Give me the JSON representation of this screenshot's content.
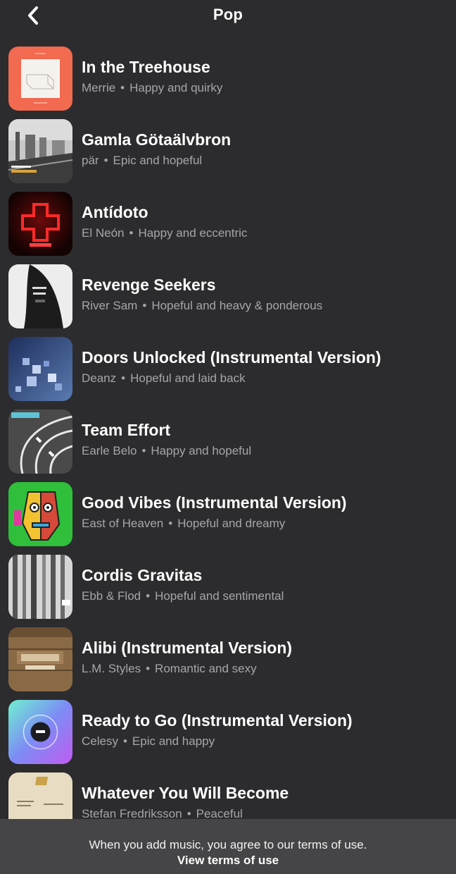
{
  "header": {
    "title": "Pop",
    "back_icon": "chevron-left-icon"
  },
  "songs": [
    {
      "title": "In the Treehouse",
      "artist": "Merrie",
      "mood": "Happy and quirky",
      "art_color": "#f26a50"
    },
    {
      "title": "Gamla Götaälvbron",
      "artist": "pär",
      "mood": "Epic and hopeful",
      "art_color": "#9a9a9a"
    },
    {
      "title": "Antídoto",
      "artist": "El Neón",
      "mood": "Happy and eccentric",
      "art_color": "#1a0606"
    },
    {
      "title": "Revenge Seekers",
      "artist": "River Sam",
      "mood": "Hopeful and heavy & ponderous",
      "art_color": "#e9e9e9"
    },
    {
      "title": "Doors Unlocked (Instrumental Version)",
      "artist": "Deanz",
      "mood": "Hopeful and laid back",
      "art_color": "#3a4f7d"
    },
    {
      "title": "Team Effort",
      "artist": "Earle Belo",
      "mood": "Happy and hopeful",
      "art_color": "#555555"
    },
    {
      "title": "Good Vibes (Instrumental Version)",
      "artist": "East of Heaven",
      "mood": "Hopeful and dreamy",
      "art_color": "#2fbf3a"
    },
    {
      "title": "Cordis Gravitas",
      "artist": "Ebb & Flod",
      "mood": "Hopeful and sentimental",
      "art_color": "#bdbdbd"
    },
    {
      "title": "Alibi (Instrumental Version)",
      "artist": "L.M. Styles",
      "mood": "Romantic and sexy",
      "art_color": "#8a6a45"
    },
    {
      "title": "Ready to Go (Instrumental Version)",
      "artist": "Celesy",
      "mood": "Epic and happy",
      "art_color": "#7b5cf0"
    },
    {
      "title": "Whatever You Will Become",
      "artist": "Stefan Fredriksson",
      "mood": "Peaceful",
      "art_color": "#e8dcc2"
    }
  ],
  "footer": {
    "notice": "When you add music, you agree to our terms of use.",
    "link": "View terms of use"
  }
}
